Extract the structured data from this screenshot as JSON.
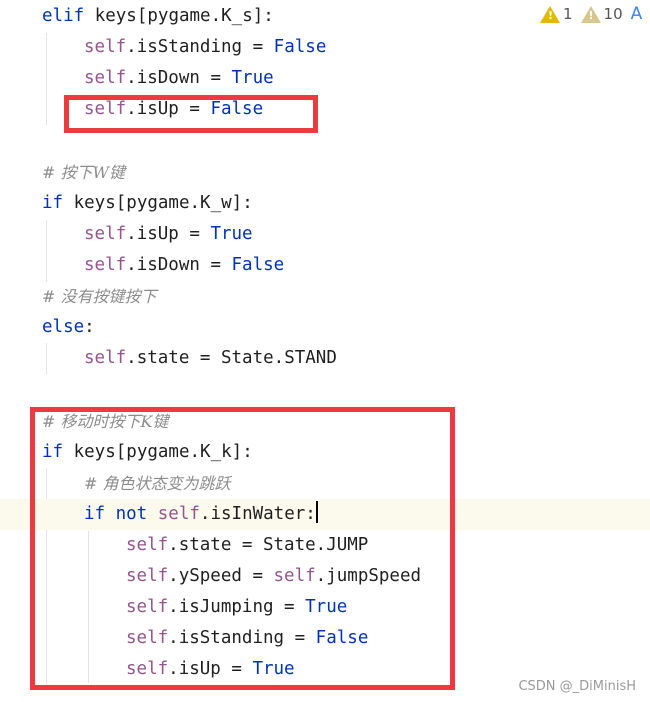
{
  "inspections": {
    "errors": "1",
    "warnings": "10",
    "reader_icon": "A"
  },
  "code": {
    "l1_kw": "elif",
    "l1_rest": " keys[pygame.K_s]:",
    "l2_self": "self",
    "l2_rest": ".isStanding = ",
    "l2_val": "False",
    "l3_self": "self",
    "l3_rest": ".isDown = ",
    "l3_val": "True",
    "l4_self": "self",
    "l4_rest": ".isUp = ",
    "l4_val": "False",
    "l5_comment": "# 按下W键",
    "l6_kw": "if",
    "l6_rest": " keys[pygame.K_w]:",
    "l7_self": "self",
    "l7_rest": ".isUp = ",
    "l7_val": "True",
    "l8_self": "self",
    "l8_rest": ".isDown = ",
    "l8_val": "False",
    "l9_comment": "# 没有按键按下",
    "l10_kw": "else",
    "l10_rest": ":",
    "l11_self": "self",
    "l11_rest": ".state = State.STAND",
    "l12_comment": "# 移动时按下K键",
    "l13_kw": "if",
    "l13_rest": " keys[pygame.K_k]:",
    "l14_comment": "# 角色状态变为跳跃",
    "l15_kw1": "if",
    "l15_kw2": " not ",
    "l15_self": "self",
    "l15_rest": ".isInWater:",
    "l16_self": "self",
    "l16_rest": ".state = State.JUMP",
    "l17_self": "self",
    "l17_mid": ".ySpeed = ",
    "l17_self2": "self",
    "l17_rest": ".jumpSpeed",
    "l18_self": "self",
    "l18_rest": ".isJumping = ",
    "l18_val": "True",
    "l19_self": "self",
    "l19_rest": ".isStanding = ",
    "l19_val": "False",
    "l20_self": "self",
    "l20_rest": ".isUp = ",
    "l20_val": "True"
  },
  "watermark": "CSDN @_DiMinisH",
  "colors": {
    "keyword": "#0033b3",
    "self": "#94558d",
    "comment": "#8c8c8c",
    "highlight_box": "#ed3a3f",
    "current_line": "#fcfaed"
  }
}
